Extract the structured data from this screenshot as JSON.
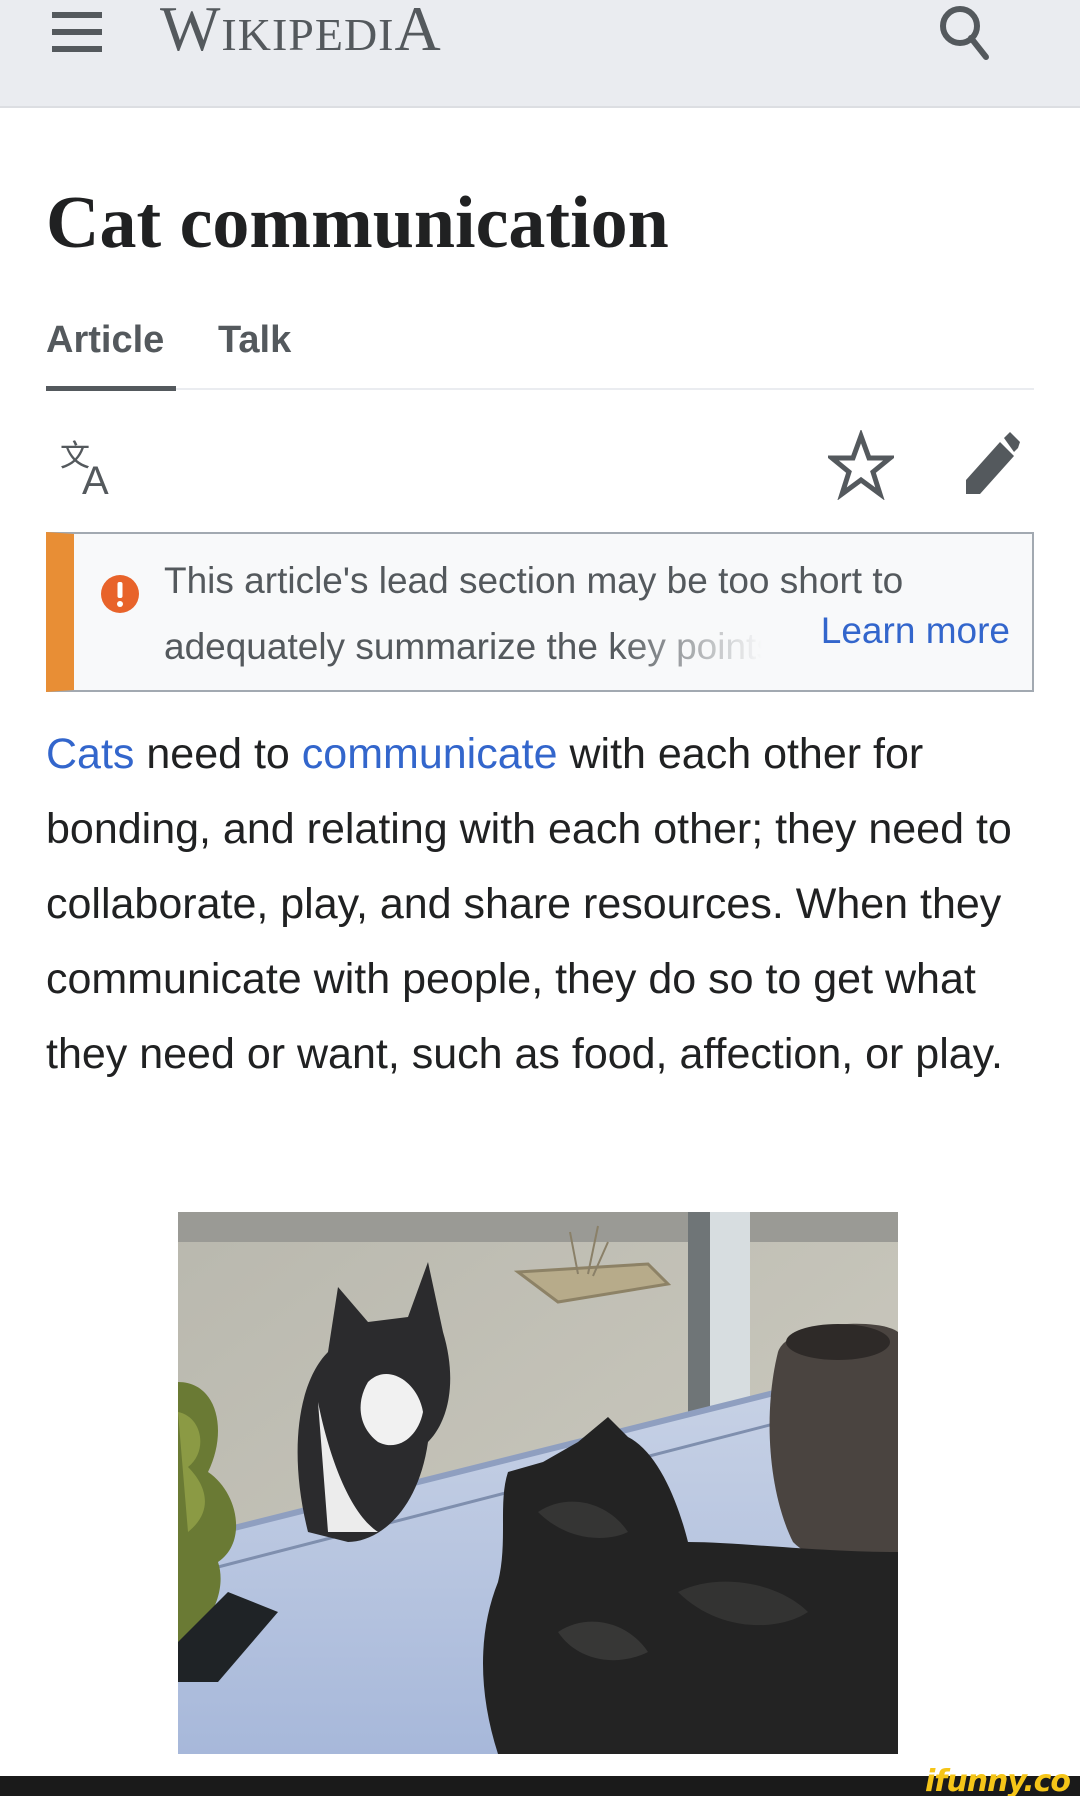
{
  "header": {
    "menu_icon": "hamburger-menu-icon",
    "wordmark_first": "W",
    "wordmark_middle": "IKIPEDI",
    "wordmark_last": "A",
    "search_icon": "search-icon"
  },
  "page": {
    "title": "Cat communication"
  },
  "tabs": [
    {
      "label": "Article",
      "active": true
    },
    {
      "label": "Talk",
      "active": false
    }
  ],
  "actions": {
    "language_icon": "language-icon",
    "watch_icon": "star-icon",
    "edit_icon": "pencil-icon"
  },
  "notice": {
    "icon": "alert-icon",
    "line1": "This article's lead section may be too short to",
    "line2": "adequately summarize the key points of its contents.",
    "learn_more": "Learn more",
    "accent_color": "#e88e35",
    "icon_color": "#e8632a"
  },
  "lead": {
    "link_cats": "Cats",
    "text_1": " need to ",
    "link_communicate": "communicate",
    "text_2": " with each other for bonding, and relating with each other; they need to collaborate, play, and share resources. When they communicate with people, they do so to get what they need or want, such as food, affection, or play."
  },
  "figure": {
    "description": "photo of two cats facing each other through a window"
  },
  "watermark": {
    "text": "ifunny.co"
  },
  "colors": {
    "link": "#3366cc",
    "header_bg": "#eaecf0",
    "text": "#202122",
    "icon": "#54595d"
  }
}
